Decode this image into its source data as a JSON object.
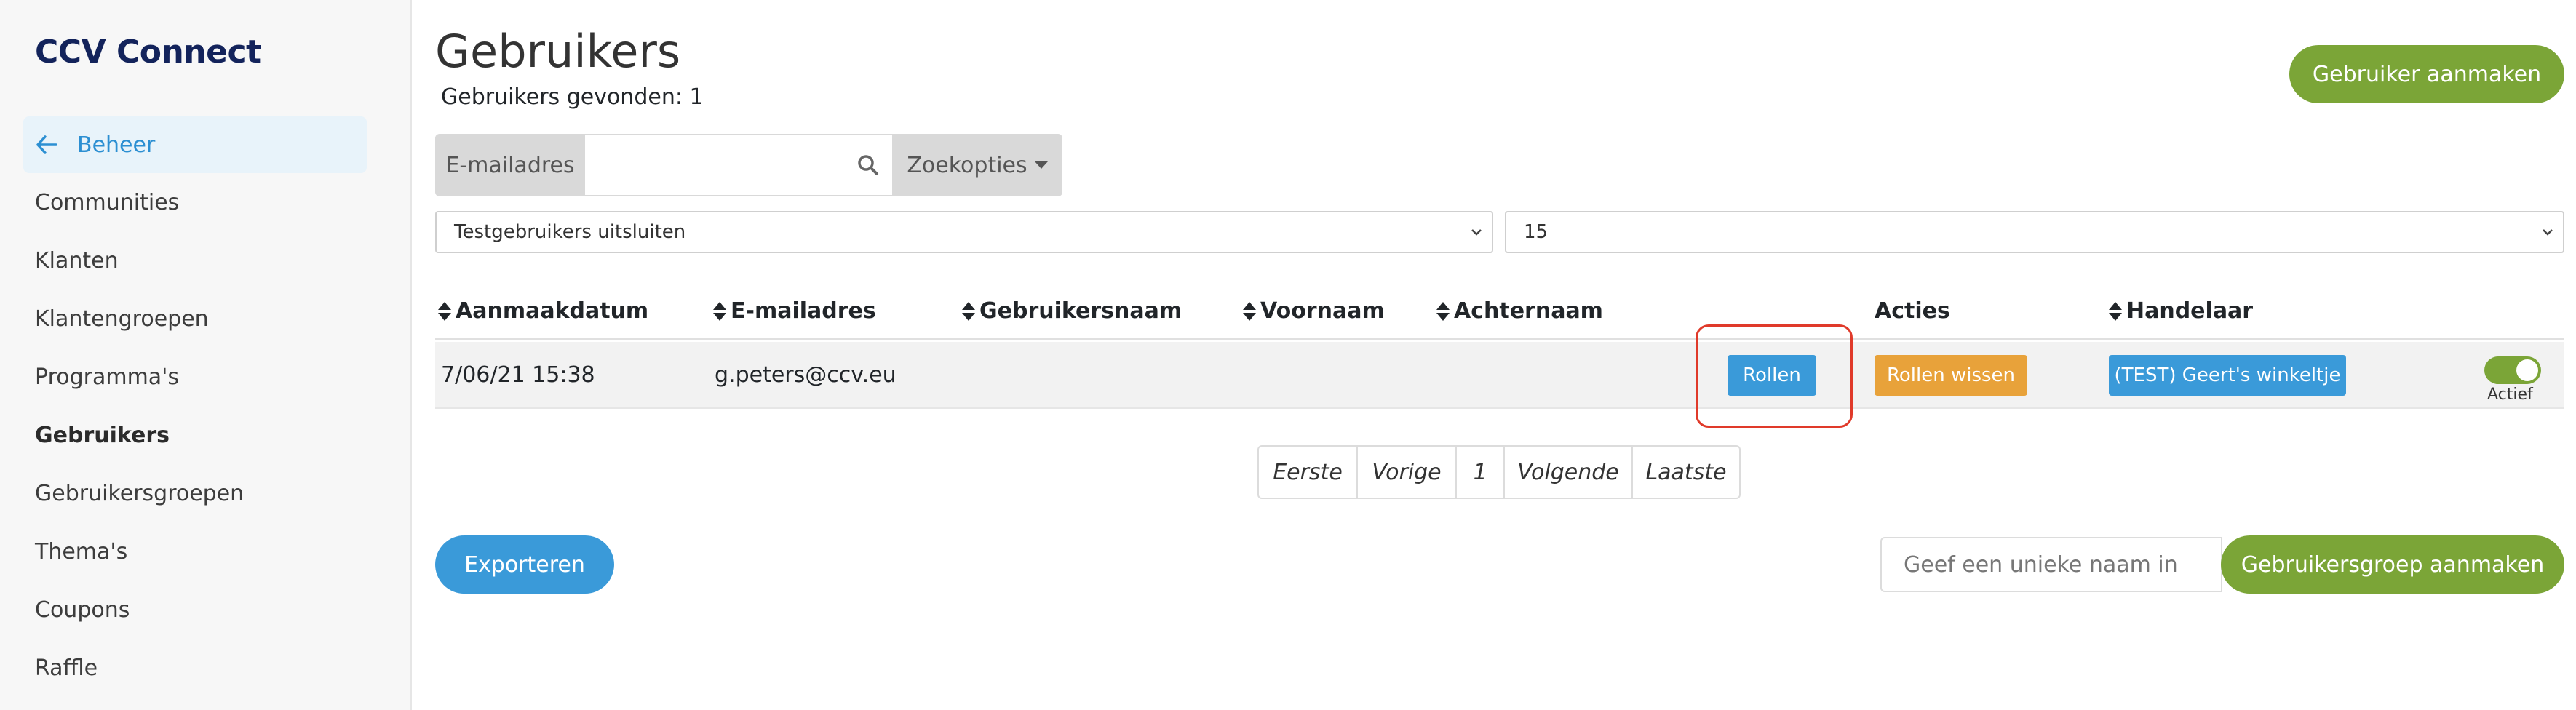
{
  "app": {
    "brand": "CCV Connect"
  },
  "sidebar": {
    "back_label": "Beheer",
    "items": [
      {
        "label": "Communities"
      },
      {
        "label": "Klanten"
      },
      {
        "label": "Klantengroepen"
      },
      {
        "label": "Programma's"
      },
      {
        "label": "Gebruikers"
      },
      {
        "label": "Gebruikersgroepen"
      },
      {
        "label": "Thema's"
      },
      {
        "label": "Coupons"
      },
      {
        "label": "Raffle"
      }
    ],
    "active_item": "Gebruikers"
  },
  "header": {
    "title": "Gebruikers",
    "found_text": "Gebruikers gevonden: 1",
    "create_user_label": "Gebruiker aanmaken"
  },
  "search": {
    "label": "E-mailadres",
    "value": "",
    "placeholder": "",
    "options_label": "Zoekopties",
    "icon": "search-icon"
  },
  "filters": {
    "test_users_selected": "Testgebruikers uitsluiten",
    "page_size_selected": "15"
  },
  "table": {
    "headers": {
      "created": "Aanmaakdatum",
      "email": "E-mailadres",
      "username": "Gebruikersnaam",
      "firstname": "Voornaam",
      "lastname": "Achternaam",
      "actions": "Acties",
      "merchant": "Handelaar"
    },
    "rows": [
      {
        "created": "7/06/21 15:38",
        "email": "g.peters@ccv.eu",
        "username": "",
        "firstname": "",
        "lastname": "",
        "roles_label": "Rollen",
        "clear_roles_label": "Rollen wissen",
        "merchant_label": "(TEST) Geert's winkeltje",
        "status_label": "Actief",
        "active": true
      }
    ]
  },
  "pagination": {
    "first": "Eerste",
    "prev": "Vorige",
    "current": "1",
    "next": "Volgende",
    "last": "Laatste"
  },
  "footer": {
    "export_label": "Exporteren",
    "group_name_placeholder": "Geef een unieke naam in",
    "create_group_label": "Gebruikersgroep aanmaken"
  },
  "colors": {
    "brand": "#13235b",
    "primary_blue": "#3a9ad9",
    "green": "#7ba537",
    "orange": "#e8a23a",
    "highlight_red": "#e03a2a"
  }
}
